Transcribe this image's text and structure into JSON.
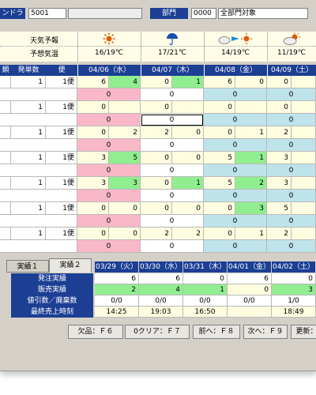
{
  "header": {
    "store_label": "ンドラ",
    "store_code": "5001",
    "dept_label": "部門",
    "dept_code": "0000",
    "dept_name": "全部門対象"
  },
  "weather": {
    "row1_label": "天気予報",
    "row2_label": "予想気温",
    "days": [
      {
        "icon": "sun-icon",
        "temp": "16/19℃"
      },
      {
        "icon": "umbrella-icon",
        "temp": "17/21℃"
      },
      {
        "icon": "cloud-to-sun-icon",
        "temp": "14/19℃"
      },
      {
        "icon": "cloud-sun-icon",
        "temp": "11/19℃"
      }
    ]
  },
  "grid_header": {
    "c0": "類",
    "c1": "発単数",
    "c2": "便",
    "dates": [
      "04/06（水）",
      "04/07（木）",
      "04/08（金）",
      "04/09（土）"
    ]
  },
  "rows": [
    {
      "count": "1",
      "bin": "1便",
      "a": [
        [
          "6",
          "4"
        ],
        [
          "0",
          "1"
        ],
        [
          "6",
          "0"
        ],
        [
          "0",
          ""
        ]
      ],
      "b": [
        "0",
        "0",
        "0",
        "0"
      ]
    },
    {
      "count": "1",
      "bin": "1便",
      "a": [
        [
          "0",
          ""
        ],
        [
          "0",
          ""
        ],
        [
          "0",
          ""
        ],
        [
          "0",
          ""
        ]
      ],
      "b": [
        "0",
        "0",
        "0",
        "0"
      ]
    },
    {
      "count": "1",
      "bin": "1便",
      "a": [
        [
          "0",
          "2"
        ],
        [
          "2",
          "0"
        ],
        [
          "0",
          "1"
        ],
        [
          "2",
          ""
        ]
      ],
      "b": [
        "0",
        "0",
        "0",
        "0"
      ]
    },
    {
      "count": "1",
      "bin": "1便",
      "a": [
        [
          "3",
          "5"
        ],
        [
          "0",
          "0"
        ],
        [
          "5",
          "1"
        ],
        [
          "3",
          ""
        ]
      ],
      "b": [
        "0",
        "0",
        "0",
        "0"
      ]
    },
    {
      "count": "1",
      "bin": "1便",
      "a": [
        [
          "3",
          "3"
        ],
        [
          "0",
          "1"
        ],
        [
          "5",
          "2"
        ],
        [
          "3",
          ""
        ]
      ],
      "b": [
        "0",
        "0",
        "0",
        "0"
      ]
    },
    {
      "count": "1",
      "bin": "1便",
      "a": [
        [
          "0",
          "0"
        ],
        [
          "0",
          "0"
        ],
        [
          "0",
          "3"
        ],
        [
          "5",
          ""
        ]
      ],
      "b": [
        "0",
        "0",
        "0",
        "0"
      ]
    },
    {
      "count": "1",
      "bin": "1便",
      "a": [
        [
          "0",
          "0"
        ],
        [
          "2",
          "2"
        ],
        [
          "0",
          "1"
        ],
        [
          "2",
          ""
        ]
      ],
      "b": [
        "0",
        "0",
        "0",
        "0"
      ]
    }
  ],
  "results": {
    "tab1": "実績１",
    "tab2": "実績２",
    "dates": [
      "03/29（火）",
      "03/30（水）",
      "03/31（木）",
      "04/01（金）",
      "04/02（土）"
    ],
    "labels": [
      "発注実績",
      "販売実績",
      "値引数／廃棄数",
      "最終売上時刻"
    ],
    "values": [
      [
        "6",
        "6",
        "0",
        "6",
        "0"
      ],
      [
        "2",
        "4",
        "1",
        "0",
        "3"
      ],
      [
        "0/0",
        "0/0",
        "0/0",
        "0/0",
        "1/0"
      ],
      [
        "14:25",
        "19:03",
        "16:50",
        "",
        "18:49"
      ]
    ]
  },
  "footer": {
    "f6": "欠品：Ｆ６",
    "f7": "0クリア：Ｆ７",
    "f8": "前へ：Ｆ８",
    "f9": "次へ：Ｆ９",
    "update": "更新："
  }
}
